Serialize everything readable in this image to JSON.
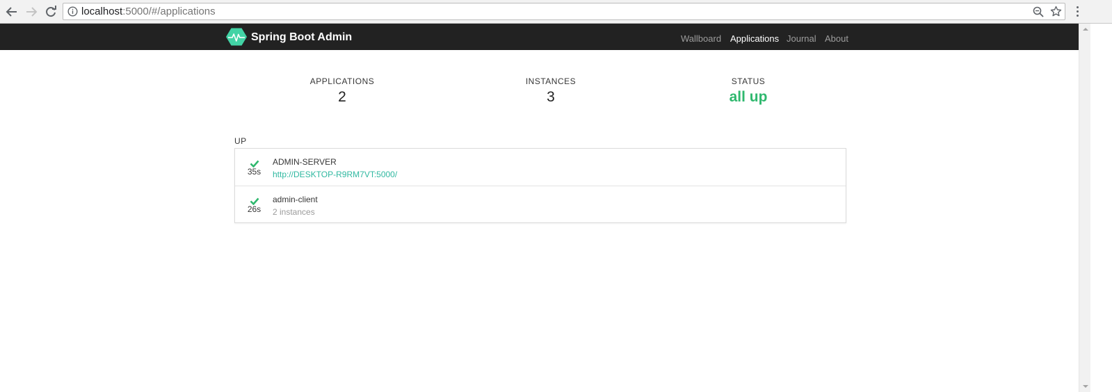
{
  "browser": {
    "url_host": "localhost",
    "url_rest": ":5000/#/applications"
  },
  "colors": {
    "navbar_bg": "#222222",
    "brand_green": "#42d3a5",
    "status_up": "#2fb86e",
    "link": "#2fb8a0"
  },
  "navbar": {
    "brand": "Spring Boot Admin",
    "items": [
      {
        "label": "Wallboard",
        "active": false
      },
      {
        "label": "Applications",
        "active": true
      },
      {
        "label": "Journal",
        "active": false
      },
      {
        "label": "About",
        "active": false
      }
    ]
  },
  "stats": {
    "applications": {
      "label": "APPLICATIONS",
      "value": "2"
    },
    "instances": {
      "label": "INSTANCES",
      "value": "3"
    },
    "status": {
      "label": "STATUS",
      "value": "all up"
    }
  },
  "group": {
    "label": "UP",
    "apps": [
      {
        "uptime": "35s",
        "name": "ADMIN-SERVER",
        "detail": "http://DESKTOP-R9RM7VT:5000/",
        "status_icon": "check-icon"
      },
      {
        "uptime": "26s",
        "name": "admin-client",
        "detail": "2 instances",
        "status_icon": "check-icon"
      }
    ]
  }
}
